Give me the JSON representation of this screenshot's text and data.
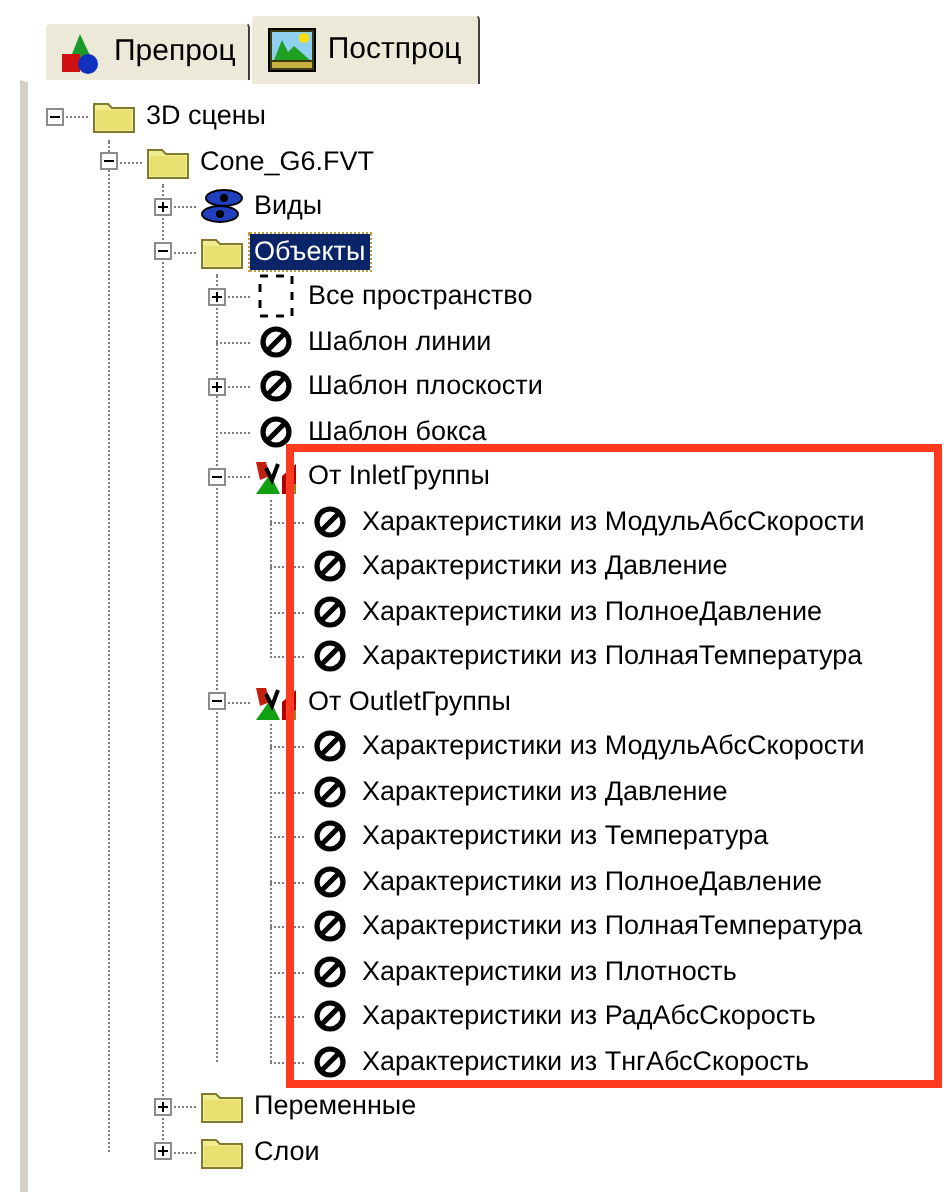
{
  "tabs": [
    {
      "label": "Препроц",
      "kind": "shapes",
      "selected": false
    },
    {
      "label": "Постпроц",
      "kind": "plot",
      "selected": true
    }
  ],
  "highlight_frame": true,
  "tree": [
    {
      "label": "3D сцены",
      "kind": "folder",
      "expanded": true,
      "selected": false,
      "children": [
        {
          "label": "Cone_G6.FVT",
          "kind": "folder",
          "expanded": true,
          "selected": false,
          "children": [
            {
              "label": "Виды",
              "kind": "views",
              "expanded": false,
              "selected": false
            },
            {
              "label": "Объекты",
              "kind": "folder",
              "expanded": true,
              "selected": true,
              "children": [
                {
                  "label": "Все пространство",
                  "kind": "space",
                  "expanded": false,
                  "selected": false
                },
                {
                  "label": "Шаблон линии",
                  "kind": "template",
                  "selected": false
                },
                {
                  "label": "Шаблон плоскости",
                  "kind": "template",
                  "expanded": false,
                  "selected": false
                },
                {
                  "label": "Шаблон бокса",
                  "kind": "template",
                  "selected": false
                },
                {
                  "label": "От InletГруппы",
                  "kind": "group",
                  "expanded": true,
                  "selected": false,
                  "children": [
                    {
                      "label": "Характеристики из МодульАбсСкорости",
                      "kind": "template",
                      "selected": false
                    },
                    {
                      "label": "Характеристики из Давление",
                      "kind": "template",
                      "selected": false
                    },
                    {
                      "label": "Характеристики из ПолноеДавление",
                      "kind": "template",
                      "selected": false
                    },
                    {
                      "label": "Характеристики из ПолнаяТемпература",
                      "kind": "template",
                      "selected": false
                    }
                  ]
                },
                {
                  "label": "От OutletГруппы",
                  "kind": "group",
                  "expanded": true,
                  "selected": false,
                  "children": [
                    {
                      "label": "Характеристики из МодульАбсСкорости",
                      "kind": "template",
                      "selected": false
                    },
                    {
                      "label": "Характеристики из Давление",
                      "kind": "template",
                      "selected": false
                    },
                    {
                      "label": "Характеристики из Температура",
                      "kind": "template",
                      "selected": false
                    },
                    {
                      "label": "Характеристики из ПолноеДавление",
                      "kind": "template",
                      "selected": false
                    },
                    {
                      "label": "Характеристики из ПолнаяТемпература",
                      "kind": "template",
                      "selected": false
                    },
                    {
                      "label": "Характеристики из Плотность",
                      "kind": "template",
                      "selected": false
                    },
                    {
                      "label": "Характеристики из РадАбсСкорость",
                      "kind": "template",
                      "selected": false
                    },
                    {
                      "label": "Характеристики из ТнгАбсСкорость",
                      "kind": "template",
                      "selected": false
                    }
                  ]
                }
              ]
            },
            {
              "label": "Переменные",
              "kind": "folder",
              "expanded": false,
              "selected": false
            },
            {
              "label": "Слои",
              "kind": "folder",
              "expanded": false,
              "selected": false
            }
          ]
        }
      ]
    }
  ]
}
